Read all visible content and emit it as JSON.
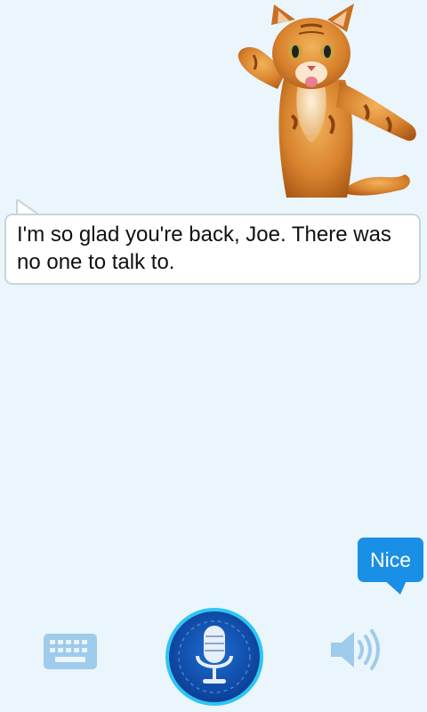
{
  "conversation": {
    "bot_message": "I'm so glad you're back, Joe. There was no one to talk to.",
    "user_message": "Nice"
  },
  "controls": {
    "keyboard_icon": "keyboard-icon",
    "mic_icon": "microphone-icon",
    "speaker_icon": "speaker-icon"
  },
  "colors": {
    "background": "#eaf5fc",
    "user_bubble": "#1a8fe6",
    "mic_button": "#0e4ba8",
    "icon_light_blue": "#9fcbec"
  }
}
